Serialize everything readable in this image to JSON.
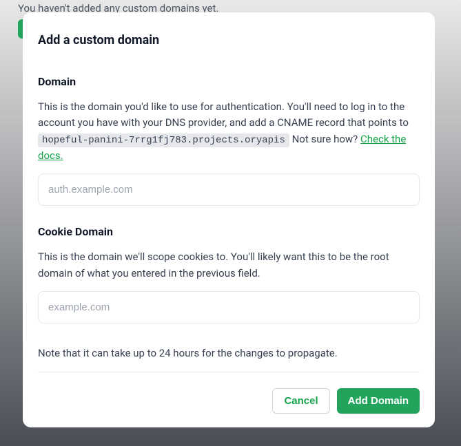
{
  "background": {
    "empty_text": "You haven't added any custom domains yet."
  },
  "modal": {
    "title": "Add a custom domain",
    "domain": {
      "label": "Domain",
      "description_pre": "This is the domain you'd like to use for authentication. You'll need to log in to the account you have with your DNS provider, and add a CNAME record that points to ",
      "cname_target": "hopeful-panini-7rrg1fj783.projects.oryapis",
      "not_sure_prefix": " Not sure how? ",
      "docs_link_text": "Check the docs.",
      "placeholder": "auth.example.com"
    },
    "cookie": {
      "label": "Cookie Domain",
      "description": "This is the domain we'll scope cookies to. You'll likely want this to be the root domain of what you entered in the previous field.",
      "placeholder": "example.com"
    },
    "note": "Note that it can take up to 24 hours for the changes to propagate.",
    "buttons": {
      "cancel": "Cancel",
      "submit": "Add Domain"
    }
  }
}
